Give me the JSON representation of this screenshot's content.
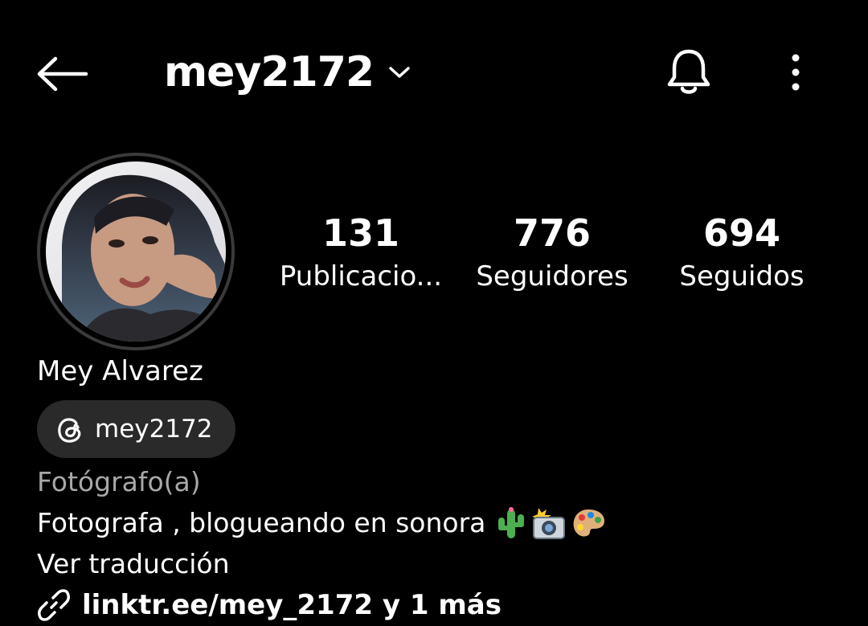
{
  "header": {
    "username": "mey2172",
    "back_icon": "arrow-left-icon",
    "dropdown_icon": "chevron-down-icon",
    "notification_icon": "bell-icon",
    "more_icon": "more-vertical-icon"
  },
  "profile": {
    "avatar_icon": "profile-photo",
    "stats": [
      {
        "number": "131",
        "label": "Publicacio..."
      },
      {
        "number": "776",
        "label": "Seguidores"
      },
      {
        "number": "694",
        "label": "Seguidos"
      }
    ],
    "full_name": "Mey Alvarez",
    "threads": {
      "icon": "threads-icon",
      "label": "mey2172"
    },
    "category": "Fotógrafo(a)",
    "bio_text": "Fotografa , blogueando en sonora",
    "bio_emojis": [
      "cactus-emoji",
      "camera-flash-emoji",
      "palette-emoji"
    ],
    "translate_label": "Ver traducción",
    "link": {
      "icon": "link-icon",
      "text": "linktr.ee/mey_2172 y 1 más"
    }
  },
  "colors": {
    "background": "#000000",
    "text": "#ffffff",
    "secondary_text": "#a8a8a8",
    "chip_background": "#2a2a2a",
    "avatar_ring": "#3a3a3a"
  }
}
